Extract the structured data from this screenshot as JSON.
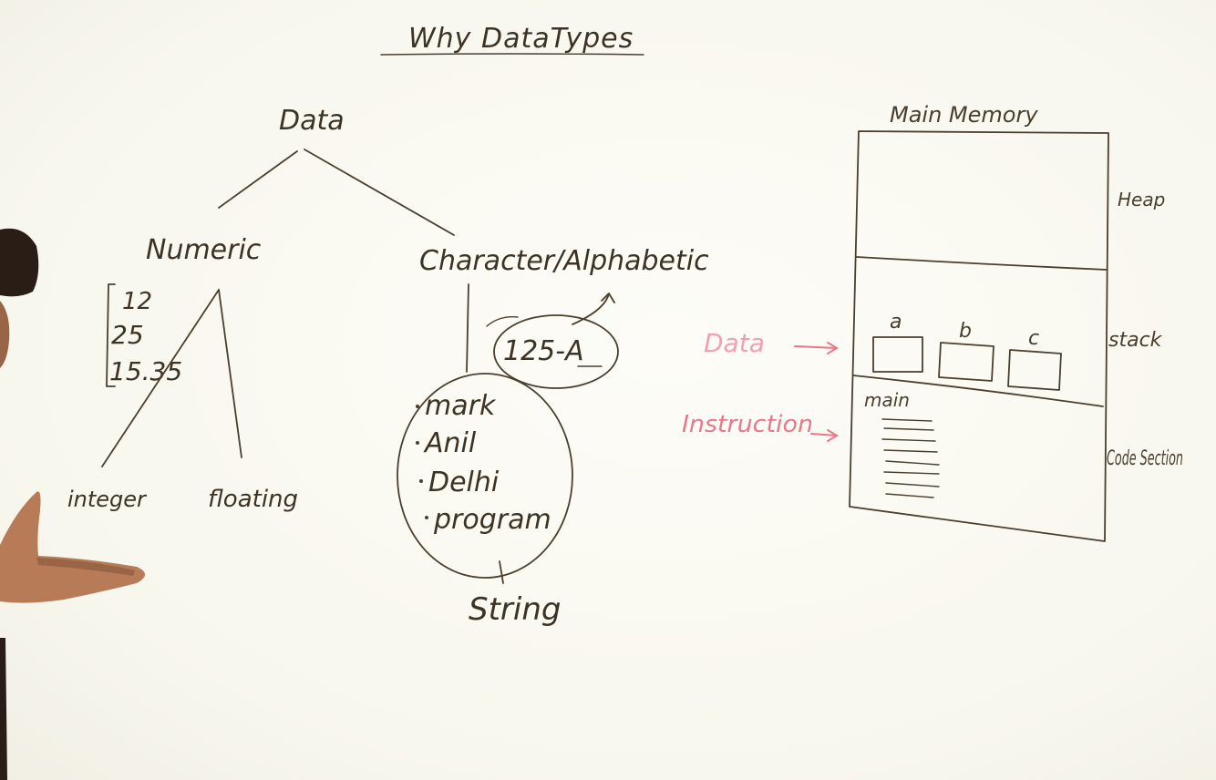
{
  "title": "Why DataTypes",
  "tree": {
    "root": "Data",
    "numeric": {
      "label": "Numeric",
      "examples": [
        "12",
        "25",
        "15.35"
      ],
      "children": [
        "integer",
        "floating"
      ]
    },
    "character": {
      "label": "Character/Alphabetic",
      "code_example": "125-A",
      "string_examples": [
        "mark",
        "Anil",
        "Delhi",
        "program"
      ],
      "string_label": "String"
    }
  },
  "memory": {
    "title": "Main Memory",
    "sections": [
      "Heap",
      "stack",
      "Code Section"
    ],
    "variables": [
      "a",
      "b",
      "c"
    ],
    "function_label": "main",
    "pointers": {
      "data": "Data",
      "instruction": "Instruction"
    }
  },
  "colors": {
    "ink": "#3d3324",
    "marker_red": "#e8788a",
    "pink_label": "#f2a0b0",
    "background": "#fbfaf3"
  },
  "icons": {
    "arrow": "arrow-right-icon",
    "presenter": "presenter-hand"
  }
}
